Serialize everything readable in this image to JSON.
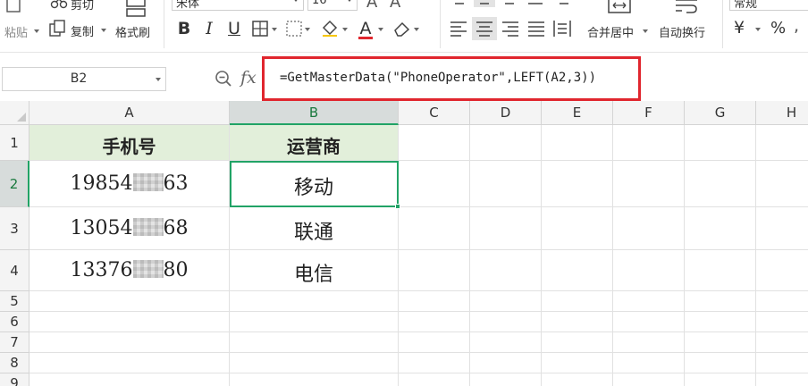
{
  "ribbon": {
    "paste_label": "粘贴",
    "cut_label": "剪切",
    "copy_label": "复制",
    "format_painter_label": "格式刷",
    "font_name": "宋体",
    "font_size": "16",
    "bold_label": "B",
    "italic_label": "I",
    "underline_label": "U",
    "font_color_label": "A",
    "merge_center_label": "合并居中",
    "wrap_text_label": "自动换行",
    "number_format": "常规",
    "currency_symbol": "¥",
    "percent_symbol": "%",
    "font_color_accent": "#e0262e"
  },
  "formula_bar": {
    "name_box": "B2",
    "fx_label": "fx",
    "formula": "=GetMasterData(\"PhoneOperator\",LEFT(A2,3))"
  },
  "sheet": {
    "columns": [
      "A",
      "B",
      "C",
      "D",
      "E",
      "F",
      "G",
      "H"
    ],
    "rows": [
      "1",
      "2",
      "3",
      "4",
      "5",
      "6",
      "7",
      "8",
      "9"
    ],
    "header": {
      "a": "手机号",
      "b": "运营商"
    },
    "data": [
      {
        "a_prefix": "19854",
        "a_suffix": "63",
        "b": "移动"
      },
      {
        "a_prefix": "13054",
        "a_suffix": "68",
        "b": "联通"
      },
      {
        "a_prefix": "13376",
        "a_suffix": "80",
        "b": "电信"
      }
    ],
    "selected_cell": "B2",
    "selection_color": "#21a366",
    "header_fill": "#e2efda"
  }
}
